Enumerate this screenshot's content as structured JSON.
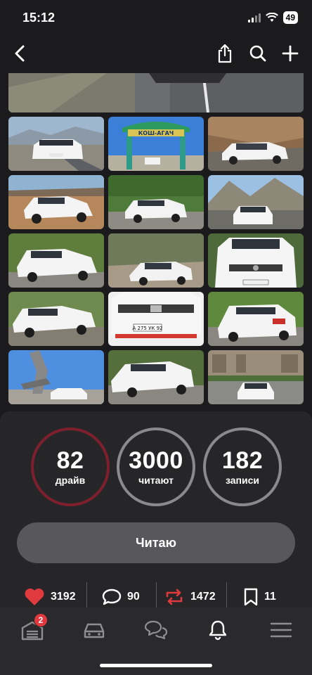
{
  "status_bar": {
    "time": "15:12",
    "battery": "49"
  },
  "nav": {
    "back_icon": "chevron-left-icon",
    "share_icon": "share-icon",
    "search_icon": "search-icon",
    "add_icon": "plus-icon"
  },
  "photos": [
    {
      "scene": "road-car"
    },
    {
      "scene": "gate-sign",
      "sign_text": "КОШ-АГАЧ"
    },
    {
      "scene": "cliff-car"
    },
    {
      "scene": "field-car"
    },
    {
      "scene": "trees-car"
    },
    {
      "scene": "mountain-car"
    },
    {
      "scene": "trees-car-2"
    },
    {
      "scene": "forest-car"
    },
    {
      "scene": "front-closeup"
    },
    {
      "scene": "parking-car"
    },
    {
      "scene": "front-plate",
      "plate_text": "А 275 УК 92"
    },
    {
      "scene": "rear-car"
    },
    {
      "scene": "monument"
    },
    {
      "scene": "garden-car"
    },
    {
      "scene": "building-car"
    }
  ],
  "stats": {
    "drive": {
      "value": "82",
      "label": "драйв"
    },
    "readers": {
      "value": "3000",
      "label": "читают"
    },
    "posts": {
      "value": "182",
      "label": "записи"
    }
  },
  "follow_button": {
    "label": "Читаю"
  },
  "actions": {
    "likes": "3192",
    "comments": "90",
    "reposts": "1472",
    "bookmarks": "11"
  },
  "tab_bar": {
    "garage_badge": "2"
  },
  "colors": {
    "accent_drive": "#7e1f2e",
    "like_red": "#e0393e",
    "repost_red": "#e0393e",
    "ring_gray": "#8a8a8e"
  }
}
